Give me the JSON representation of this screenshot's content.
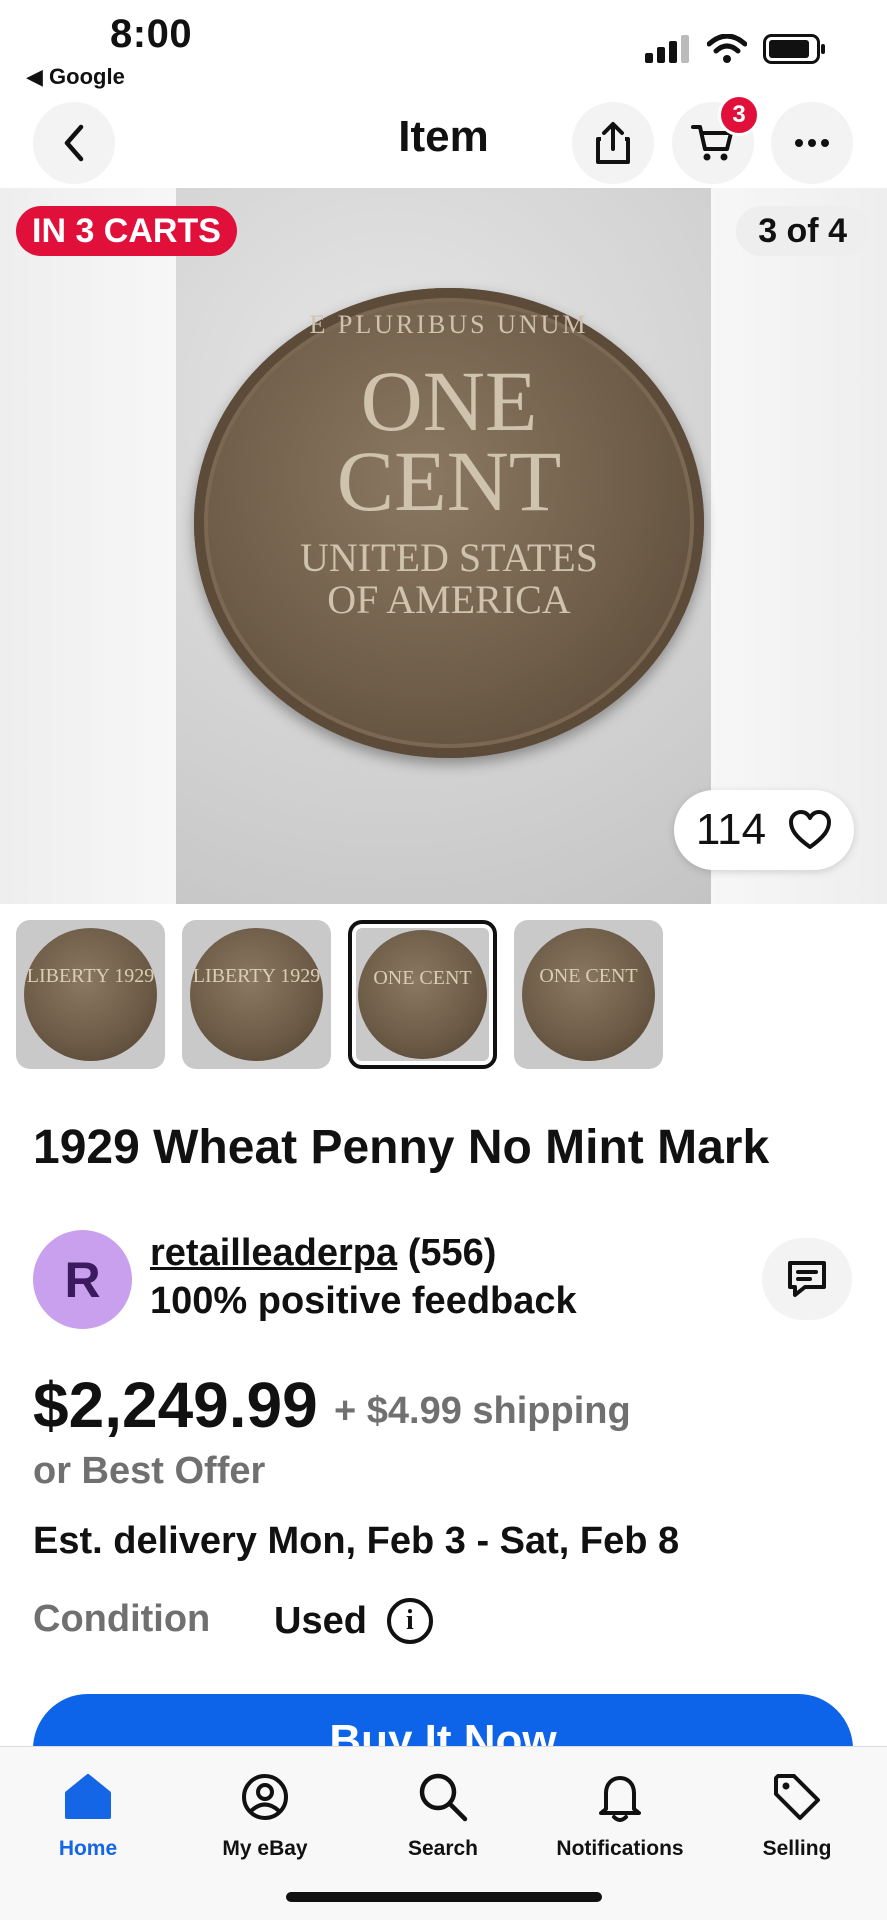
{
  "status_bar": {
    "time": "8:00",
    "back_app": "◀ Google"
  },
  "header": {
    "title": "Item",
    "cart_count": "3"
  },
  "gallery": {
    "carts_badge": "IN 3 CARTS",
    "image_counter": "3 of 4",
    "watch_count": "114",
    "coin_text": {
      "top": "E PLURIBUS UNUM",
      "one": "ONE",
      "cent": "CENT",
      "usa1": "UNITED STATES",
      "usa2": "OF AMERICA"
    },
    "thumbnails": [
      {
        "kind": "obverse",
        "text": "LIBERTY 1929"
      },
      {
        "kind": "obverse",
        "text": "LIBERTY 1929"
      },
      {
        "kind": "reverse",
        "text": "ONE CENT",
        "selected": true
      },
      {
        "kind": "reverse",
        "text": "ONE CENT"
      }
    ]
  },
  "item": {
    "title": "1929 Wheat Penny No Mint Mark"
  },
  "seller": {
    "avatar_letter": "R",
    "name": "retailleaderpa",
    "rating_count": "(556)",
    "feedback": "100% positive feedback"
  },
  "pricing": {
    "price": "$2,249.99",
    "shipping": "+ $4.99 shipping",
    "best_offer": "or Best Offer",
    "delivery": "Est. delivery Mon, Feb 3 - Sat, Feb 8"
  },
  "condition": {
    "label": "Condition",
    "value": "Used"
  },
  "actions": {
    "buy_now": "Buy It Now"
  },
  "tabs": [
    {
      "label": "Home",
      "icon": "home-icon",
      "active": true
    },
    {
      "label": "My eBay",
      "icon": "profile-icon"
    },
    {
      "label": "Search",
      "icon": "search-icon"
    },
    {
      "label": "Notifications",
      "icon": "bell-icon"
    },
    {
      "label": "Selling",
      "icon": "tag-icon"
    }
  ],
  "colors": {
    "accent": "#0d64e8",
    "badge": "#e0103a",
    "avatar": "#c9a0ee"
  }
}
